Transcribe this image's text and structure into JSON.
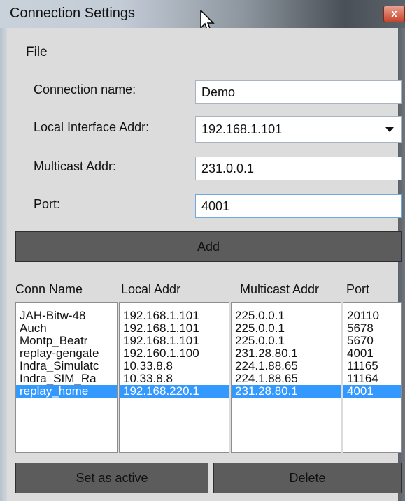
{
  "window": {
    "title": "Connection Settings",
    "close_glyph": "x"
  },
  "menu": {
    "file": "File"
  },
  "form": {
    "connection_name_label": "Connection name:",
    "connection_name_value": "Demo",
    "local_interface_label": "Local Interface Addr:",
    "local_interface_value": "192.168.1.101",
    "multicast_label": "Multicast Addr:",
    "multicast_value": "231.0.0.1",
    "port_label": "Port:",
    "port_value": "4001",
    "add_button": "Add"
  },
  "table": {
    "headers": [
      "Conn Name",
      "Local Addr",
      "Multicast Addr",
      "Port"
    ],
    "rows": [
      [
        "JAH-Bitw-48",
        "192.168.1.101",
        "225.0.0.1",
        "20110"
      ],
      [
        "Auch",
        "192.168.1.101",
        "225.0.0.1",
        "5678"
      ],
      [
        "Montp_Beatr",
        "192.168.1.101",
        "225.0.0.1",
        "5670"
      ],
      [
        "replay-gengate",
        "192.160.1.100",
        "231.28.80.1",
        "4001"
      ],
      [
        "Indra_Simulatc",
        "10.33.8.8",
        "224.1.88.65",
        "11165"
      ],
      [
        "Indra_SIM_Ra",
        "10.33.8.8",
        "224.1.88.65",
        "11164"
      ],
      [
        "replay_home",
        "192.168.220.1",
        "231.28.80.1",
        "4001"
      ]
    ],
    "selected_row": 6
  },
  "buttons": {
    "set_active": "Set as active",
    "delete": "Delete"
  },
  "colors": {
    "selection": "#3399ff",
    "button_bg": "#5c5c5c",
    "client_bg": "#dcdcdc"
  }
}
